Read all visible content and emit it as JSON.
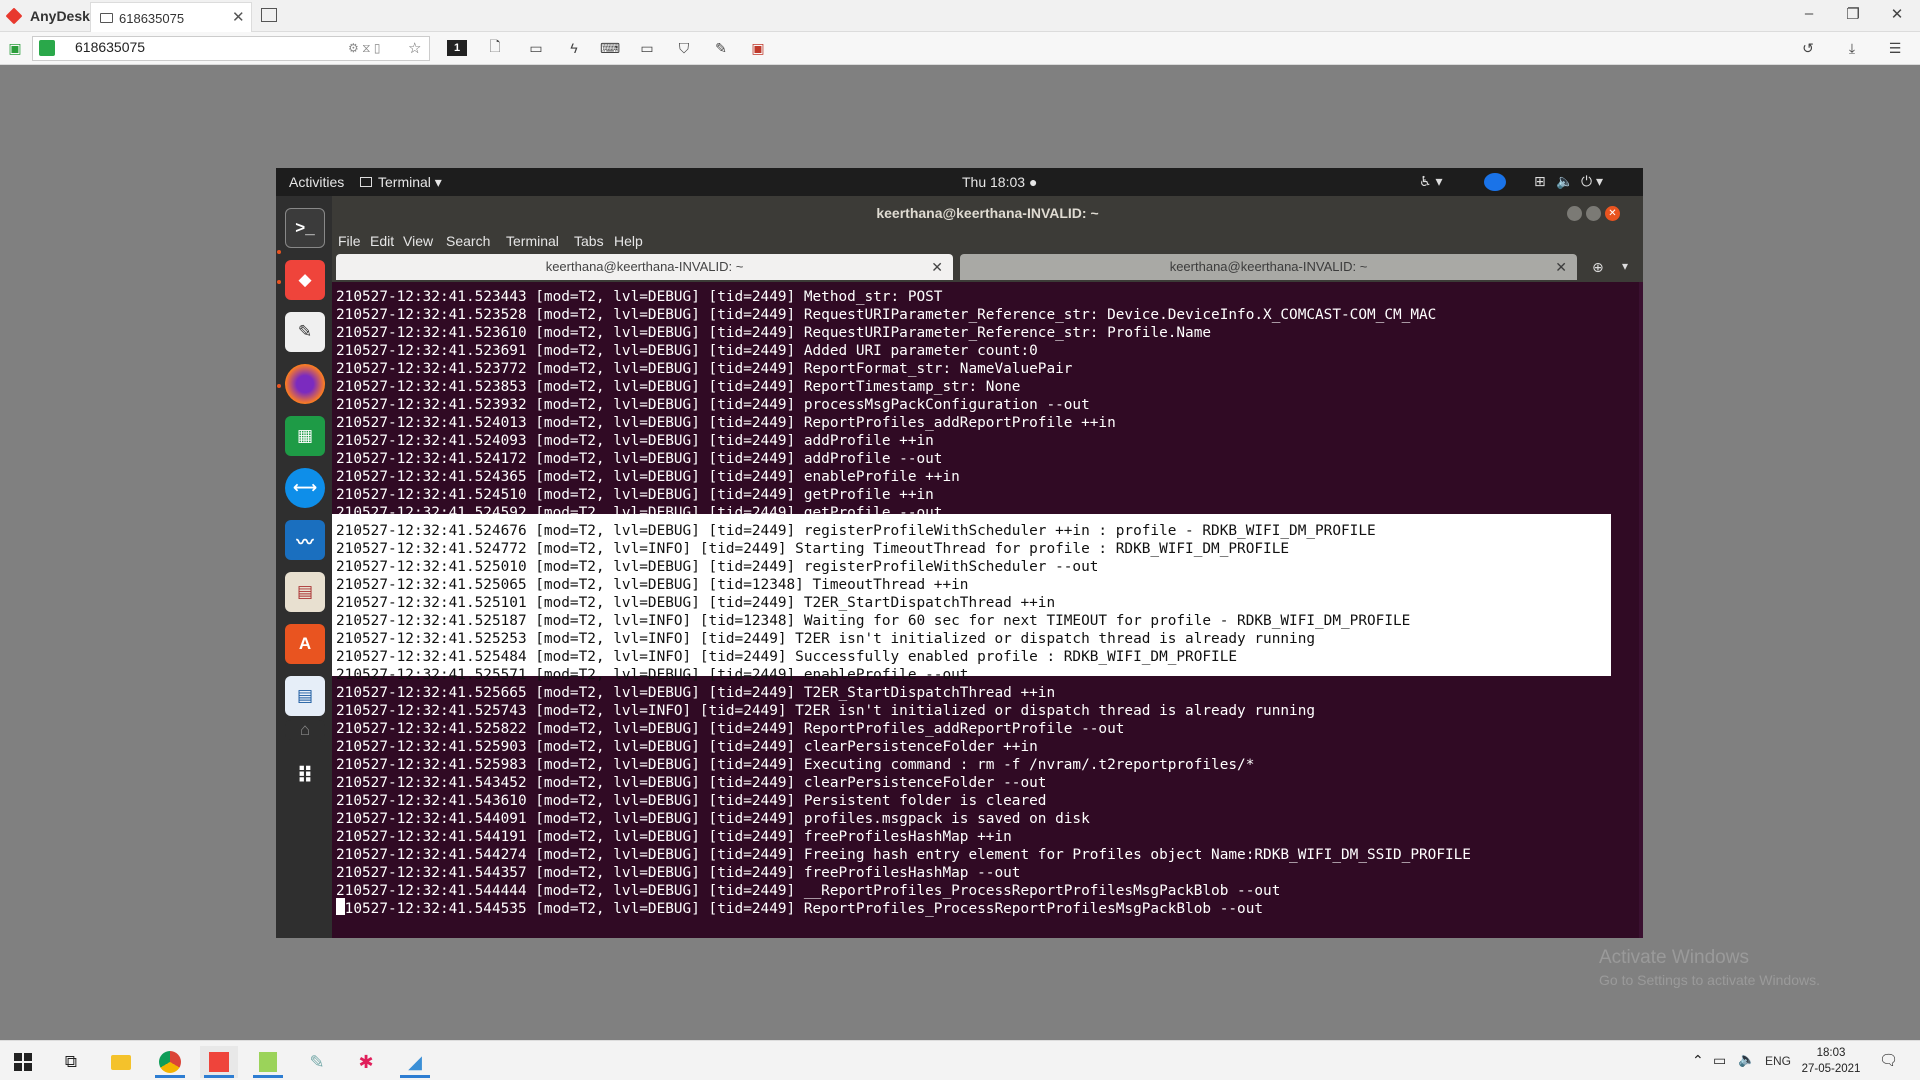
{
  "anydesk": {
    "app_name": "AnyDesk",
    "tab_label": "618635075",
    "address": "618635075"
  },
  "ubuntu": {
    "activities": "Activities",
    "app_menu": "Terminal ▾",
    "clock": "Thu 18:03 ●"
  },
  "terminal": {
    "title": "keerthana@keerthana-INVALID: ~",
    "menu": [
      "File",
      "Edit",
      "View",
      "Search",
      "Terminal",
      "Tabs",
      "Help"
    ],
    "tabs": [
      {
        "label": "keerthana@keerthana-INVALID: ~",
        "active": true
      },
      {
        "label": "keerthana@keerthana-INVALID: ~",
        "active": false
      }
    ],
    "highlighted_range": [
      13,
      21
    ],
    "lines": [
      "210527-12:32:41.523443 [mod=T2, lvl=DEBUG] [tid=2449] Method_str: POST",
      "210527-12:32:41.523528 [mod=T2, lvl=DEBUG] [tid=2449] RequestURIParameter_Reference_str: Device.DeviceInfo.X_COMCAST-COM_CM_MAC",
      "210527-12:32:41.523610 [mod=T2, lvl=DEBUG] [tid=2449] RequestURIParameter_Reference_str: Profile.Name",
      "210527-12:32:41.523691 [mod=T2, lvl=DEBUG] [tid=2449] Added URI parameter count:0",
      "210527-12:32:41.523772 [mod=T2, lvl=DEBUG] [tid=2449] ReportFormat_str: NameValuePair",
      "210527-12:32:41.523853 [mod=T2, lvl=DEBUG] [tid=2449] ReportTimestamp_str: None",
      "210527-12:32:41.523932 [mod=T2, lvl=DEBUG] [tid=2449] processMsgPackConfiguration --out",
      "210527-12:32:41.524013 [mod=T2, lvl=DEBUG] [tid=2449] ReportProfiles_addReportProfile ++in",
      "210527-12:32:41.524093 [mod=T2, lvl=DEBUG] [tid=2449] addProfile ++in",
      "210527-12:32:41.524172 [mod=T2, lvl=DEBUG] [tid=2449] addProfile --out",
      "210527-12:32:41.524365 [mod=T2, lvl=DEBUG] [tid=2449] enableProfile ++in",
      "210527-12:32:41.524510 [mod=T2, lvl=DEBUG] [tid=2449] getProfile ++in",
      "210527-12:32:41.524592 [mod=T2, lvl=DEBUG] [tid=2449] getProfile --out",
      "210527-12:32:41.524676 [mod=T2, lvl=DEBUG] [tid=2449] registerProfileWithScheduler ++in : profile - RDKB_WIFI_DM_PROFILE",
      "210527-12:32:41.524772 [mod=T2, lvl=INFO] [tid=2449] Starting TimeoutThread for profile : RDKB_WIFI_DM_PROFILE",
      "210527-12:32:41.525010 [mod=T2, lvl=DEBUG] [tid=2449] registerProfileWithScheduler --out",
      "210527-12:32:41.525065 [mod=T2, lvl=DEBUG] [tid=12348] TimeoutThread ++in",
      "210527-12:32:41.525101 [mod=T2, lvl=DEBUG] [tid=2449] T2ER_StartDispatchThread ++in",
      "210527-12:32:41.525187 [mod=T2, lvl=INFO] [tid=12348] Waiting for 60 sec for next TIMEOUT for profile - RDKB_WIFI_DM_PROFILE",
      "210527-12:32:41.525253 [mod=T2, lvl=INFO] [tid=2449] T2ER isn't initialized or dispatch thread is already running",
      "210527-12:32:41.525484 [mod=T2, lvl=INFO] [tid=2449] Successfully enabled profile : RDKB_WIFI_DM_PROFILE",
      "210527-12:32:41.525571 [mod=T2, lvl=DEBUG] [tid=2449] enableProfile --out",
      "210527-12:32:41.525665 [mod=T2, lvl=DEBUG] [tid=2449] T2ER_StartDispatchThread ++in",
      "210527-12:32:41.525743 [mod=T2, lvl=INFO] [tid=2449] T2ER isn't initialized or dispatch thread is already running",
      "210527-12:32:41.525822 [mod=T2, lvl=DEBUG] [tid=2449] ReportProfiles_addReportProfile --out",
      "210527-12:32:41.525903 [mod=T2, lvl=DEBUG] [tid=2449] clearPersistenceFolder ++in",
      "210527-12:32:41.525983 [mod=T2, lvl=DEBUG] [tid=2449] Executing command : rm -f /nvram/.t2reportprofiles/*",
      "210527-12:32:41.543452 [mod=T2, lvl=DEBUG] [tid=2449] clearPersistenceFolder --out",
      "210527-12:32:41.543610 [mod=T2, lvl=DEBUG] [tid=2449] Persistent folder is cleared",
      "210527-12:32:41.544091 [mod=T2, lvl=DEBUG] [tid=2449] profiles.msgpack is saved on disk",
      "210527-12:32:41.544191 [mod=T2, lvl=DEBUG] [tid=2449] freeProfilesHashMap ++in",
      "210527-12:32:41.544274 [mod=T2, lvl=DEBUG] [tid=2449] Freeing hash entry element for Profiles object Name:RDKB_WIFI_DM_SSID_PROFILE",
      "210527-12:32:41.544357 [mod=T2, lvl=DEBUG] [tid=2449] freeProfilesHashMap --out",
      "210527-12:32:41.544444 [mod=T2, lvl=DEBUG] [tid=2449] __ReportProfiles_ProcessReportProfilesMsgPackBlob --out",
      "210527-12:32:41.544535 [mod=T2, lvl=DEBUG] [tid=2449] ReportProfiles_ProcessReportProfilesMsgPackBlob --out"
    ]
  },
  "watermark": {
    "title": "Activate Windows",
    "subtitle": "Go to Settings to activate Windows."
  },
  "taskbar": {
    "language": "ENG",
    "time": "18:03",
    "date": "27-05-2021"
  }
}
